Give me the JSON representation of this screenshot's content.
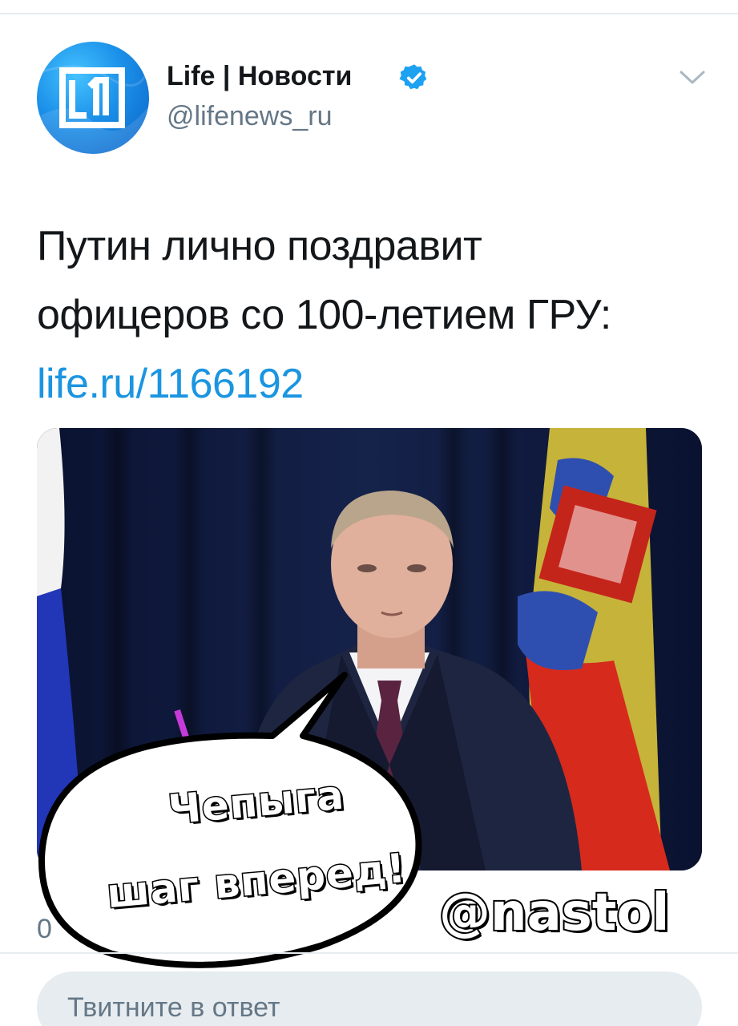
{
  "tweet": {
    "author": {
      "display_name": "Life | Новости",
      "handle": "@lifenews_ru",
      "verified": true,
      "avatar_icon": "life-logo-icon"
    },
    "text_lines": [
      "Путин лично поздравит",
      "офицеров со 100-летием ГРУ:"
    ],
    "link": "life.ru/1166192",
    "menu_icon": "chevron-down-icon",
    "partial_text": "0"
  },
  "overlay": {
    "speech_bubble_lines": [
      "Чепыга",
      "шаг вперед!"
    ],
    "watermark": "@nastol"
  },
  "reply": {
    "placeholder": "Твитните в ответ"
  },
  "colors": {
    "link": "#1b95e0",
    "verified_badge": "#1da1f2",
    "muted_text": "#657786",
    "divider": "#e6ecf0"
  }
}
